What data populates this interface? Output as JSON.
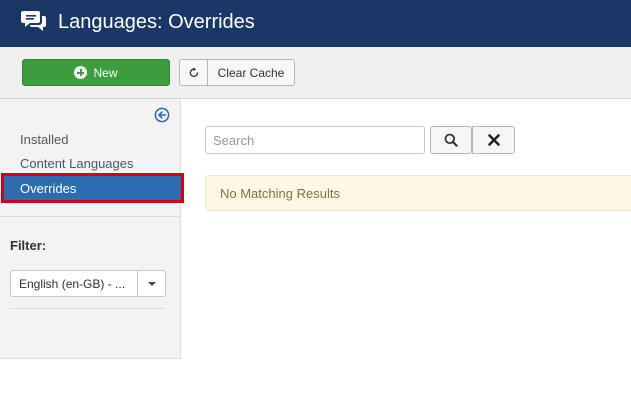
{
  "header": {
    "title": "Languages: Overrides",
    "icon": "comments-icon"
  },
  "toolbar": {
    "new_label": "New",
    "clear_cache_label": "Clear Cache"
  },
  "sidebar": {
    "items": [
      {
        "label": "Installed",
        "active": false
      },
      {
        "label": "Content Languages",
        "active": false
      },
      {
        "label": "Overrides",
        "active": true
      }
    ],
    "filter_label": "Filter:",
    "filter_value": "English (en-GB) - ..."
  },
  "main": {
    "search_placeholder": "Search",
    "search_value": "",
    "no_results": "No Matching Results"
  },
  "colors": {
    "header": "#1a3867",
    "new_button": "#3c9d3c",
    "active_item": "#2d6cae",
    "highlight": "#d0021b",
    "alert_bg": "#fcf8e3"
  }
}
